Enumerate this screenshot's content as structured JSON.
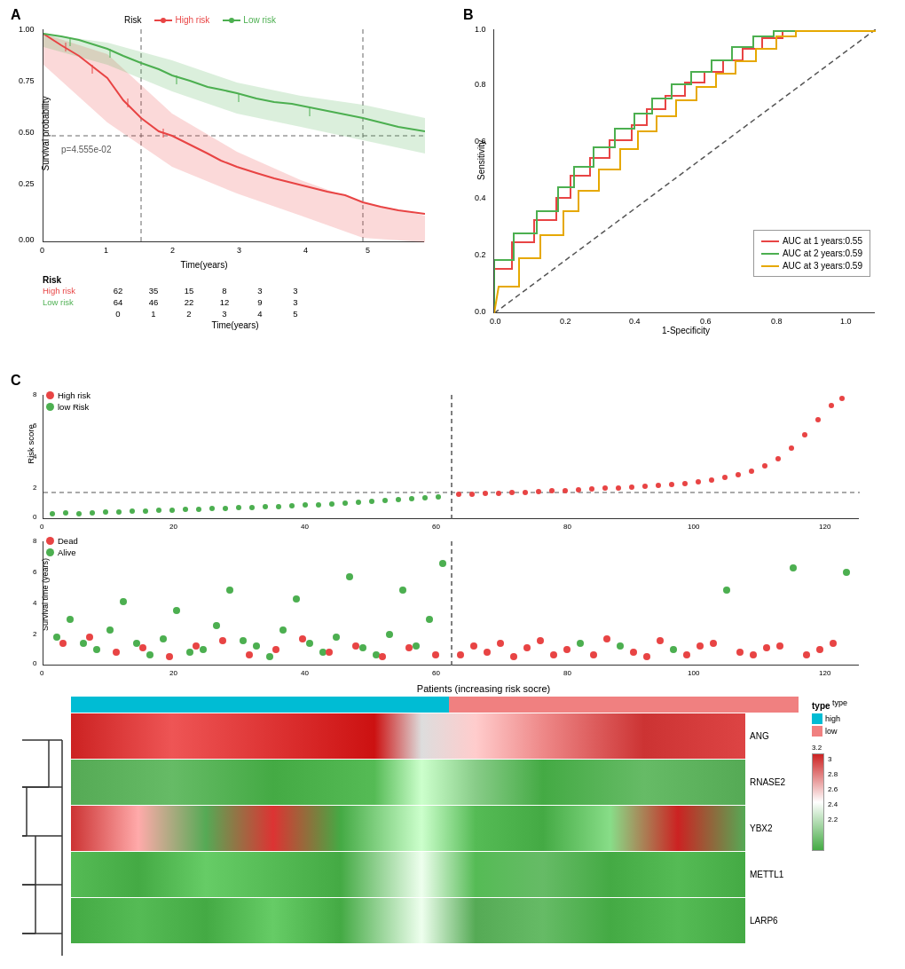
{
  "panels": {
    "A": {
      "label": "A",
      "legend": {
        "high_risk": "High risk",
        "low_risk": "Low risk"
      },
      "yaxis_label": "Survival probability",
      "xaxis_label": "Time(years)",
      "pvalue": "p=4.555e-02",
      "yticks": [
        "0.00",
        "0.25",
        "0.50",
        "0.75",
        "1.00"
      ],
      "xticks": [
        "0",
        "1",
        "2",
        "3",
        "4",
        "5"
      ],
      "risk_table": {
        "high_risk_label": "High risk",
        "low_risk_label": "Low risk",
        "high_risk_values": [
          "62",
          "35",
          "15",
          "8",
          "3",
          "3"
        ],
        "low_risk_values": [
          "64",
          "46",
          "22",
          "12",
          "9",
          "3"
        ],
        "time_points": [
          "0",
          "1",
          "2",
          "3",
          "4",
          "5"
        ],
        "risk_label": "Risk",
        "xaxis_label": "Time(years)"
      }
    },
    "B": {
      "label": "B",
      "yaxis_label": "Sensitivity",
      "xaxis_label": "1-Specificity",
      "yticks": [
        "0.0",
        "0.2",
        "0.4",
        "0.6",
        "0.8",
        "1.0"
      ],
      "xticks": [
        "0.0",
        "0.2",
        "0.4",
        "0.6",
        "0.8",
        "1.0"
      ],
      "legend": {
        "auc1": "AUC at 1 years:0.55",
        "auc2": "AUC at 2 years:0.59",
        "auc3": "AUC at 3 years:0.59"
      }
    },
    "C": {
      "label": "C",
      "scatter_top": {
        "yaxis_label": "Risk score",
        "legend": {
          "high_risk": "High risk",
          "low_risk": "low Risk"
        },
        "yticks": [
          "0",
          "2",
          "4",
          "6",
          "8"
        ],
        "xticks": [
          "0",
          "20",
          "40",
          "60",
          "80",
          "100",
          "120"
        ]
      },
      "scatter_bottom": {
        "yaxis_label": "Survival time (years)",
        "legend": {
          "dead": "Dead",
          "alive": "Alive"
        },
        "yticks": [
          "0",
          "2",
          "4",
          "6",
          "8"
        ],
        "xticks": [
          "0",
          "20",
          "40",
          "60",
          "80",
          "100",
          "120"
        ],
        "xaxis_label": "Patients (increasing risk socre)"
      },
      "heatmap": {
        "title": "Patients (increasing risk socre)",
        "genes": [
          "ANG",
          "RNASE2",
          "YBX2",
          "METTL1",
          "LARP6"
        ],
        "type_label": "type",
        "legend_title": "type",
        "legend_high": "high",
        "legend_low": "low",
        "color_scale": {
          "max": "3.2",
          "mid1": "3",
          "mid2": "2.8",
          "mid3": "2.6",
          "mid4": "2.4",
          "min": "2.2"
        }
      }
    }
  }
}
